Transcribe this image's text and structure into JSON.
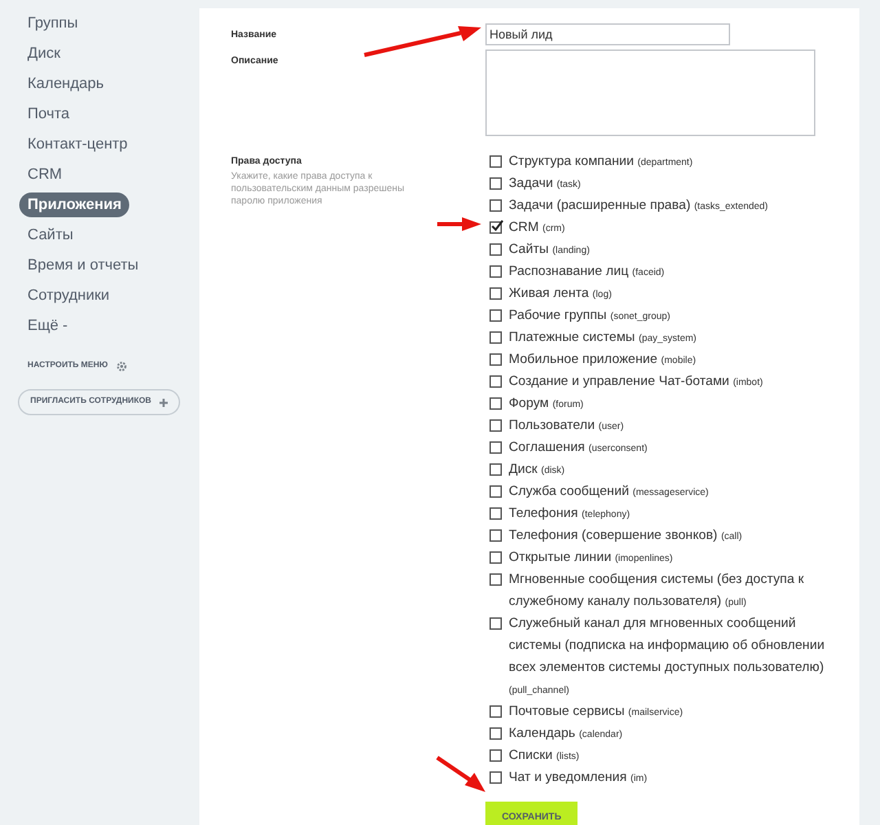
{
  "sidebar": {
    "items": [
      {
        "label": "Группы",
        "selected": false
      },
      {
        "label": "Диск",
        "selected": false
      },
      {
        "label": "Календарь",
        "selected": false
      },
      {
        "label": "Почта",
        "selected": false
      },
      {
        "label": "Контакт-центр",
        "selected": false
      },
      {
        "label": "CRM",
        "selected": false
      },
      {
        "label": "Приложения",
        "selected": true
      },
      {
        "label": "Сайты",
        "selected": false
      },
      {
        "label": "Время и отчеты",
        "selected": false
      },
      {
        "label": "Сотрудники",
        "selected": false
      },
      {
        "label": "Ещё -",
        "selected": false
      }
    ],
    "configure_menu": "НАСТРОИТЬ МЕНЮ",
    "invite_button": "ПРИГЛАСИТЬ СОТРУДНИКОВ"
  },
  "form": {
    "name_label": "Название",
    "name_value": "Новый лид",
    "description_label": "Описание",
    "access_label": "Права доступа",
    "access_hint": "Укажите, какие права доступа к пользовательским данным разрешены паролю приложения",
    "permissions": [
      {
        "label": "Структура компании",
        "code": "(department)",
        "checked": false
      },
      {
        "label": "Задачи",
        "code": "(task)",
        "checked": false
      },
      {
        "label": "Задачи (расширенные права)",
        "code": "(tasks_extended)",
        "checked": false
      },
      {
        "label": "CRM",
        "code": "(crm)",
        "checked": true
      },
      {
        "label": "Сайты",
        "code": "(landing)",
        "checked": false
      },
      {
        "label": "Распознавание лиц",
        "code": "(faceid)",
        "checked": false
      },
      {
        "label": "Живая лента",
        "code": "(log)",
        "checked": false
      },
      {
        "label": "Рабочие группы",
        "code": "(sonet_group)",
        "checked": false
      },
      {
        "label": "Платежные системы",
        "code": "(pay_system)",
        "checked": false
      },
      {
        "label": "Мобильное приложение",
        "code": "(mobile)",
        "checked": false
      },
      {
        "label": "Создание и управление Чат-ботами",
        "code": "(imbot)",
        "checked": false
      },
      {
        "label": "Форум",
        "code": "(forum)",
        "checked": false
      },
      {
        "label": "Пользователи",
        "code": "(user)",
        "checked": false
      },
      {
        "label": "Соглашения",
        "code": "(userconsent)",
        "checked": false
      },
      {
        "label": "Диск",
        "code": "(disk)",
        "checked": false
      },
      {
        "label": "Служба сообщений",
        "code": "(messageservice)",
        "checked": false
      },
      {
        "label": "Телефония",
        "code": "(telephony)",
        "checked": false
      },
      {
        "label": "Телефония (совершение звонков)",
        "code": "(call)",
        "checked": false
      },
      {
        "label": "Открытые линии",
        "code": "(imopenlines)",
        "checked": false
      },
      {
        "label": "Мгновенные сообщения системы (без доступа к служебному каналу пользователя)",
        "code": "(pull)",
        "checked": false
      },
      {
        "label": "Служебный канал для мгновенных сообщений системы (подписка на информацию об обновлении всех элементов системы доступных пользователю)",
        "code": "(pull_channel)",
        "checked": false
      },
      {
        "label": "Почтовые сервисы",
        "code": "(mailservice)",
        "checked": false
      },
      {
        "label": "Календарь",
        "code": "(calendar)",
        "checked": false
      },
      {
        "label": "Списки",
        "code": "(lists)",
        "checked": false
      },
      {
        "label": "Чат и уведомления",
        "code": "(im)",
        "checked": false
      }
    ],
    "save_button": "СОХРАНИТЬ"
  }
}
